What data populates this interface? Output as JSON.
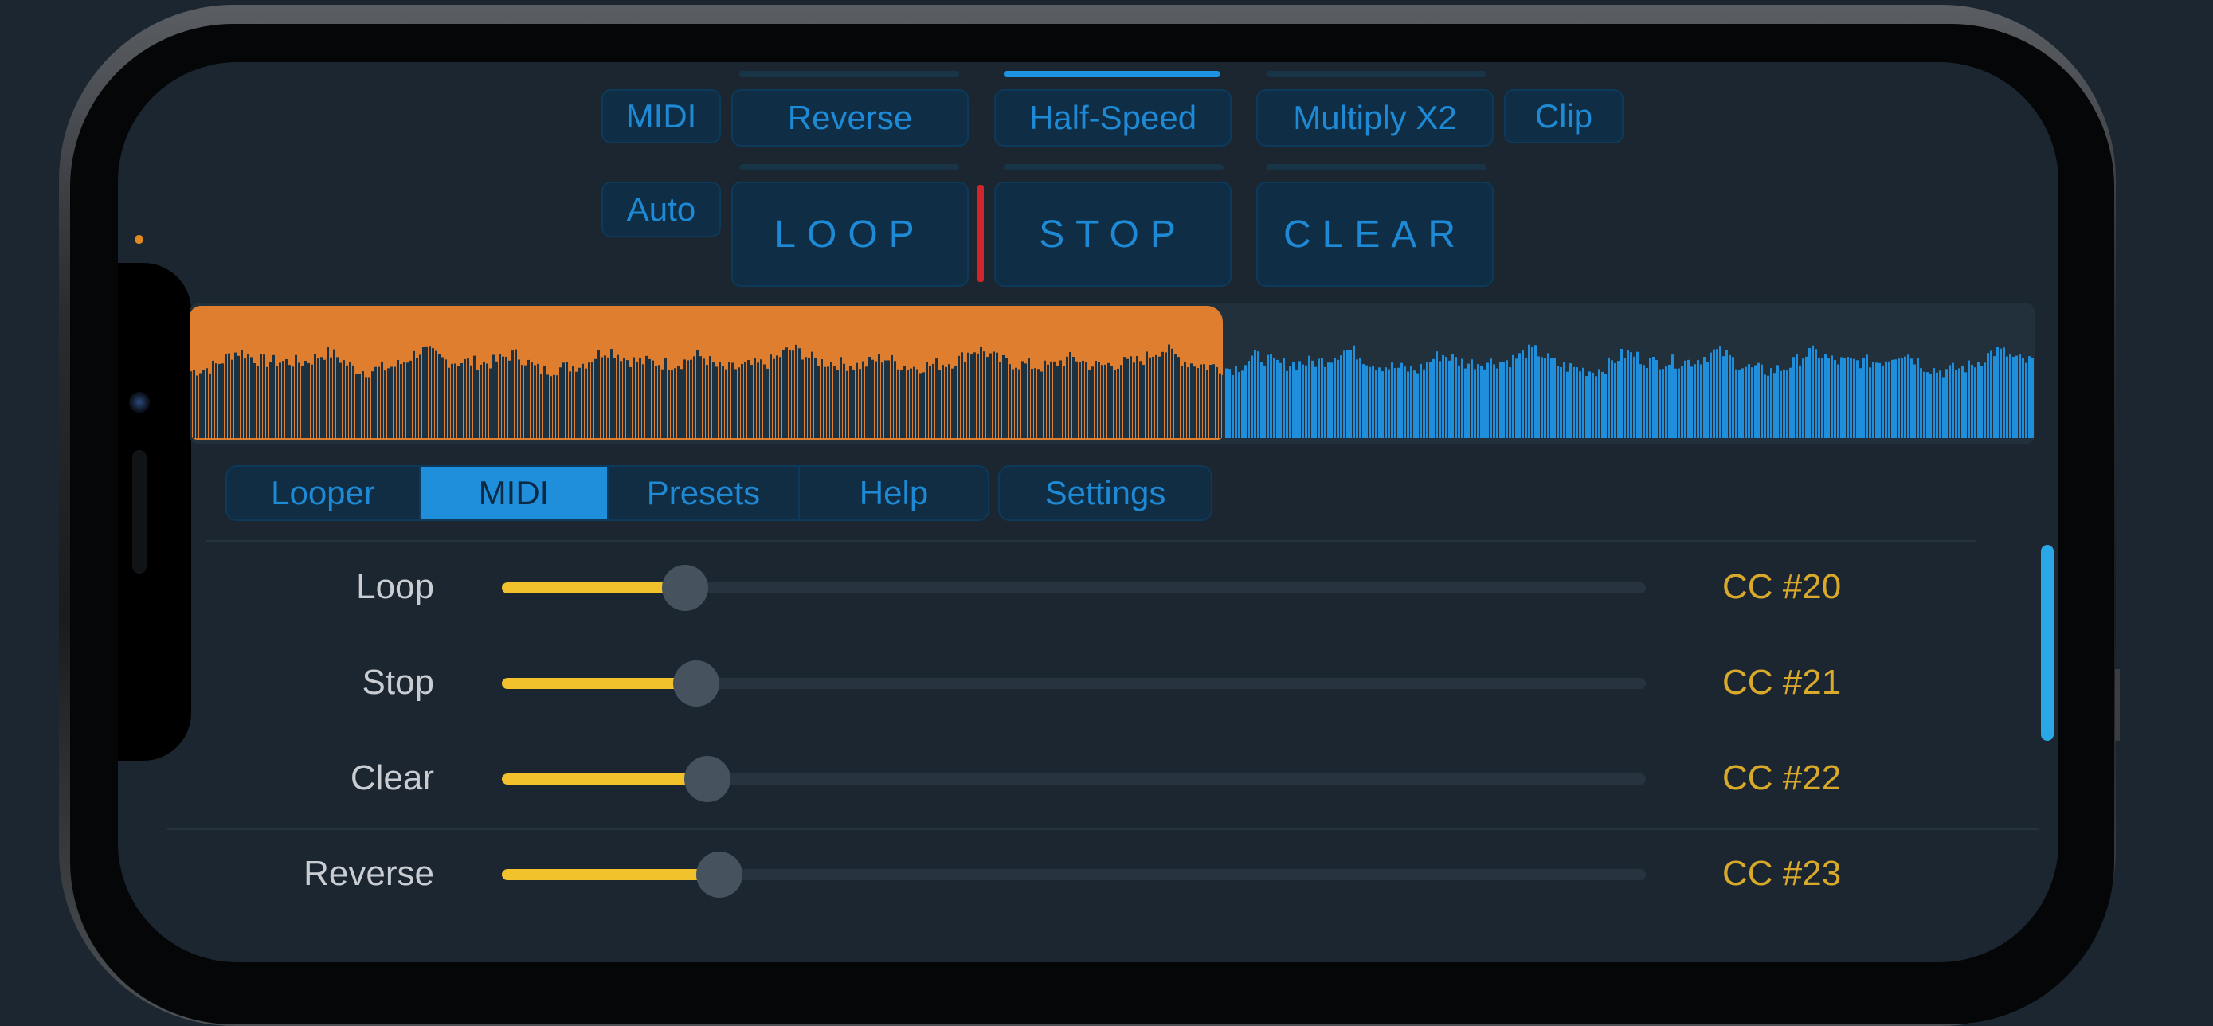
{
  "toolbar": {
    "midi_label": "MIDI",
    "reverse_label": "Reverse",
    "half_speed_label": "Half-Speed",
    "multiply_label": "Multiply X2",
    "clip_label": "Clip",
    "auto_label": "Auto",
    "loop_label": "LOOP",
    "stop_label": "STOP",
    "clear_label": "CLEAR",
    "active_mode": "Half-Speed"
  },
  "waveform": {
    "played_fraction": 0.56,
    "played_color": "#e07e30",
    "unplayed_color": "#1f8fdc"
  },
  "tabs": [
    {
      "label": "Looper",
      "active": false
    },
    {
      "label": "MIDI",
      "active": true
    },
    {
      "label": "Presets",
      "active": false
    },
    {
      "label": "Help",
      "active": false
    },
    {
      "label": "Settings",
      "active": false
    }
  ],
  "midi_mappings": [
    {
      "label": "Loop",
      "value": 0.16,
      "cc": "CC #20"
    },
    {
      "label": "Stop",
      "value": 0.17,
      "cc": "CC #21"
    },
    {
      "label": "Clear",
      "value": 0.18,
      "cc": "CC #22"
    },
    {
      "label": "Reverse",
      "value": 0.19,
      "cc": "CC #23"
    }
  ],
  "colors": {
    "accent": "#1f8fdc",
    "slider_fill": "#f2c22c",
    "cc_text": "#d9a92a",
    "loop_indicator": "#d2262c"
  }
}
